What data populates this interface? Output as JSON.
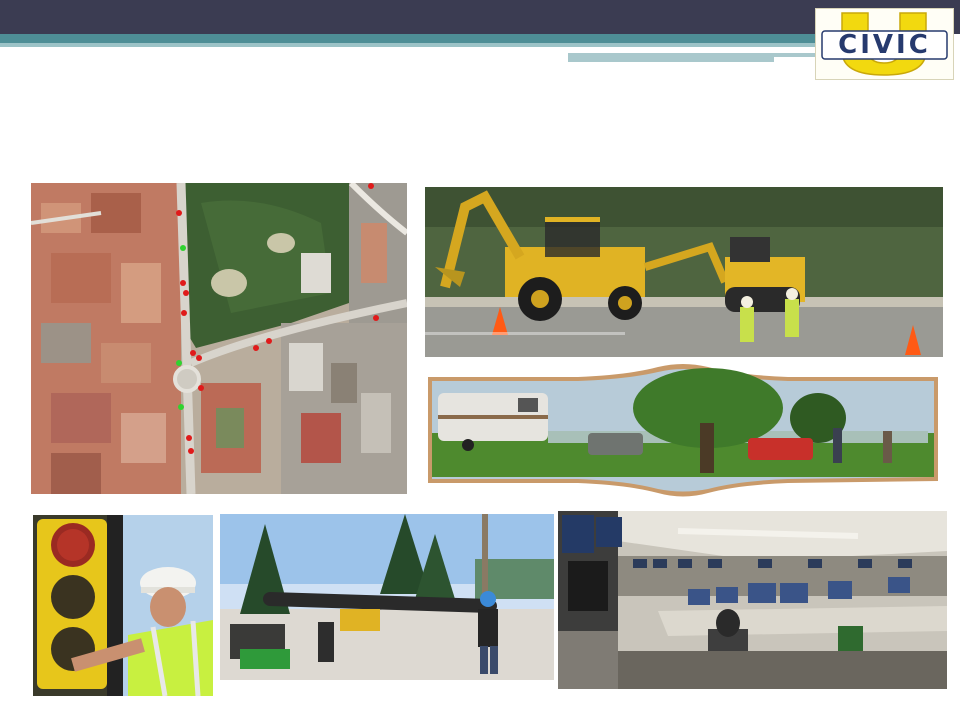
{
  "logo": {
    "letter": "U",
    "text": "CIVIC"
  },
  "icons": {
    "aerial_map": "aerial-map-image",
    "construction": "road-construction-image",
    "park": "park-rv-image",
    "traffic": "traffic-signal-worker-image",
    "pipe": "pipe-installation-image",
    "control": "control-room-image"
  },
  "colors": {
    "header_bar": "#3b3c52",
    "accent_teal": "#4e8e96",
    "logo_yellow": "#f2d90f",
    "logo_blue": "#263a6e"
  }
}
